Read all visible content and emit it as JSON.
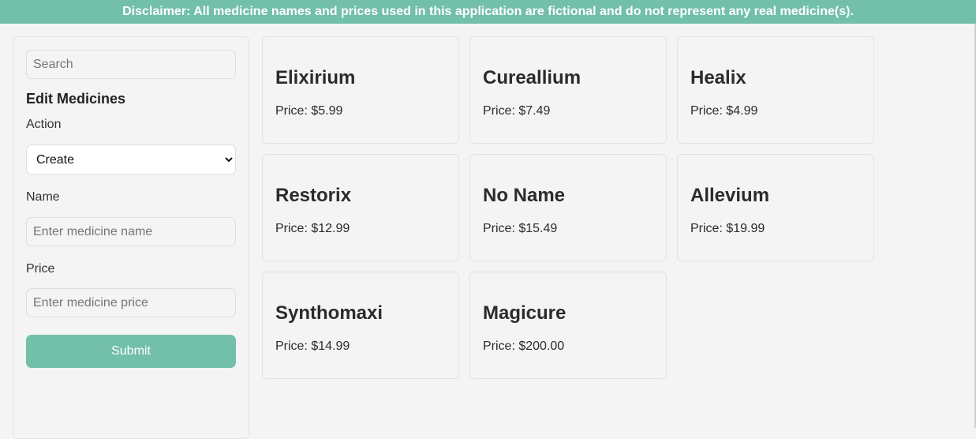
{
  "banner": {
    "text": "Disclaimer: All medicine names and prices used in this application are fictional and do not represent any real medicine(s)."
  },
  "sidebar": {
    "search_placeholder": "Search",
    "section_title": "Edit Medicines",
    "action_label": "Action",
    "action_selected": "Create",
    "name_label": "Name",
    "name_placeholder": "Enter medicine name",
    "price_label": "Price",
    "price_placeholder": "Enter medicine price",
    "submit_label": "Submit"
  },
  "medicines": [
    {
      "name": "Elixirium",
      "price": "Price: $5.99"
    },
    {
      "name": "Cureallium",
      "price": "Price: $7.49"
    },
    {
      "name": "Healix",
      "price": "Price: $4.99"
    },
    {
      "name": "Restorix",
      "price": "Price: $12.99"
    },
    {
      "name": "No Name",
      "price": "Price: $15.49"
    },
    {
      "name": "Allevium",
      "price": "Price: $19.99"
    },
    {
      "name": "Synthomaxi",
      "price": "Price: $14.99"
    },
    {
      "name": "Magicure",
      "price": "Price: $200.00"
    }
  ],
  "colors": {
    "accent": "#72bfaa",
    "background": "#f4f4f4"
  }
}
